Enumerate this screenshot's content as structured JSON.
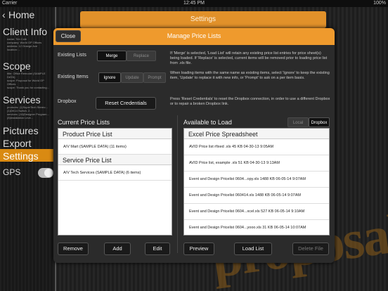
{
  "statusbar": {
    "carrier": "Carrier",
    "time": "12:45 PM",
    "battery": "100%"
  },
  "sidebar": {
    "back_label": "Home",
    "client_info": {
      "heading": "Client Info",
      "lines": [
        "name: Tim Cole",
        "company: World GP Offices",
        "address: 12 Orange Ave",
        "location: ..."
      ]
    },
    "scope": {
      "heading": "Scope",
      "lines": [
        "title: Office Remodel (SAMPLE DATA)",
        "scope: Proposal for World GP Offices",
        "scope: Thank you for contacting..."
      ]
    },
    "services": {
      "heading": "Services",
      "lines": [
        "products: (1)SuperTech Stereo...",
        "(1)DK14 Switch, 2...",
        "services: (16)Designer Program...",
        "(8)Installation Leve..."
      ]
    },
    "items": [
      "Pictures",
      "Export",
      "Settings",
      "GPS"
    ]
  },
  "settings_bar": {
    "title": "Settings"
  },
  "watermark": {
    "text": "proposal"
  },
  "modal": {
    "title": "Manage Price Lists",
    "close_label": "Close",
    "existing_lists": {
      "label": "Existing Lists",
      "options": [
        "Merge",
        "Replace"
      ],
      "selected": "Merge",
      "description": "If 'Merge' is selected, 'Load List' will retain any existing price list entries for price sheet(s) being loaded.  If 'Replace' is selected, current items will be removed prior to loading price list from .xls file."
    },
    "existing_items": {
      "label": "Existing Items",
      "options": [
        "Ignore",
        "Update",
        "Prompt"
      ],
      "selected": "Ignore",
      "description": "When loading items with the same name as existing items, select 'Ignore' to keep the existing item, 'Update' to replace it with new info, or 'Prompt' to ask on a per item basis."
    },
    "dropbox": {
      "label": "Dropbox",
      "button_label": "Reset Credentials",
      "description": "Press 'Reset Credentials' to reset the Dropbox connection, in order to use a different Dropbox or to repair a broken Dropbox link."
    },
    "current_lists": {
      "label": "Current Price Lists",
      "sections": [
        {
          "header": "Product Price List",
          "rows": [
            "A/V Mart (SAMPLE DATA) (11 items)"
          ]
        },
        {
          "header": "Service Price List",
          "rows": [
            "A/V Tech Services (SAMPLE DATA) (6 items)"
          ]
        }
      ],
      "buttons": [
        "Remove",
        "Add",
        "Edit"
      ]
    },
    "available": {
      "label": "Available to Load",
      "source_options": [
        "Local",
        "Dropbox"
      ],
      "source_selected": "Dropbox",
      "header": "Excel Price Spreadsheet",
      "rows": [
        "AVID Price list rfixed .xls 45 KB 04-30-13 9:05AM",
        "AVID Price list, example .xls 51 KB 04-30-13 9:13AM",
        "Event and Design Pricelist 0604...opy.xls 1488 KB 06-05-14 9:07AM",
        "Event and Design Pricelist 060414.xls 1488 KB 06-05-14 9:07AM",
        "Event and Design Pricelist 0604...xcel.xls 527 KB 06-05-14 9:10AM",
        "Event and Design Pricelist 0604...yooo.xls 31 KB 06-05-14 10:07AM"
      ],
      "buttons": [
        "Preview",
        "Load List",
        "Delete File"
      ]
    }
  }
}
